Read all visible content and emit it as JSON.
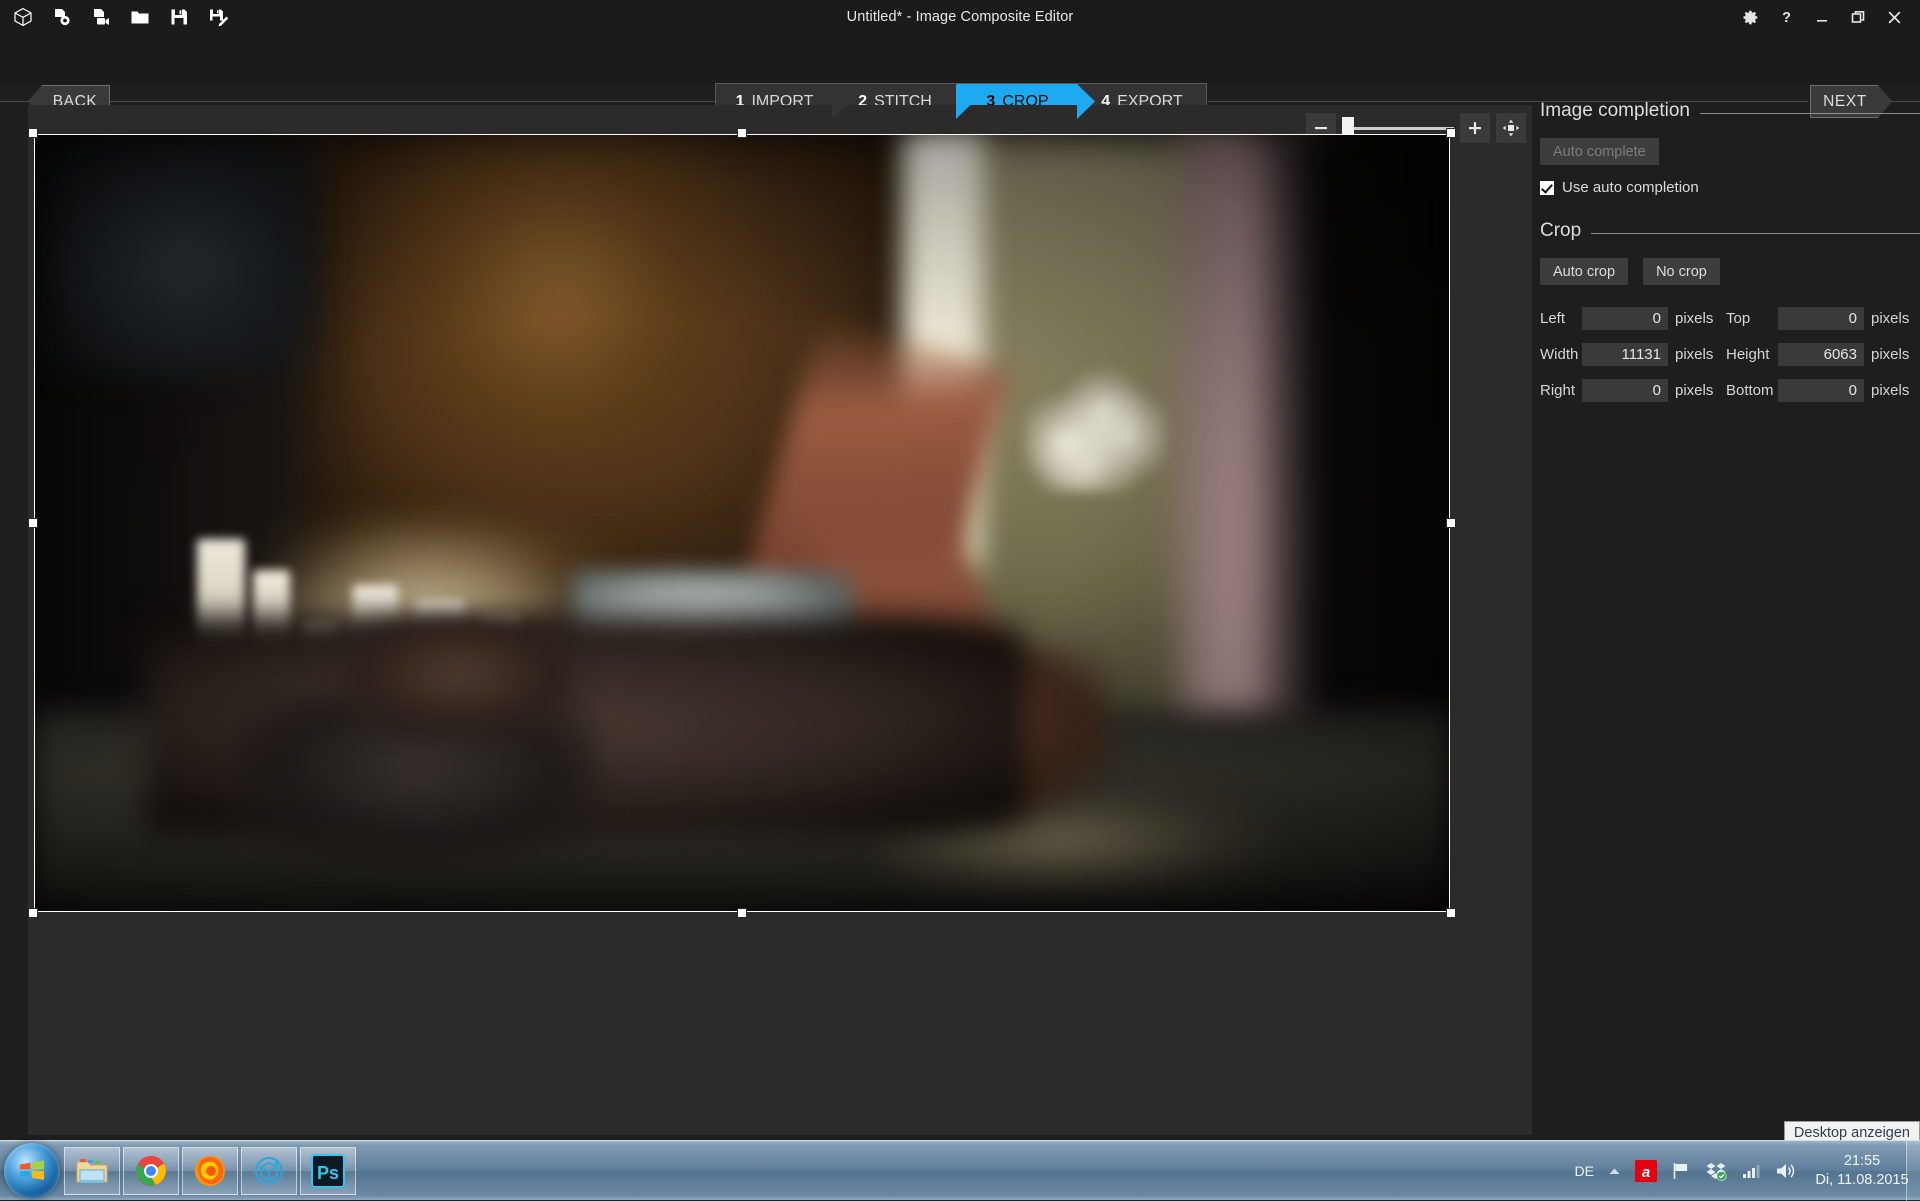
{
  "window": {
    "title": "Untitled* - Image Composite Editor",
    "toolbar_icons": [
      {
        "name": "app-cube-icon",
        "label": "Image Composite Editor"
      },
      {
        "name": "new-panorama-from-images-icon",
        "label": "New panorama from images"
      },
      {
        "name": "new-panorama-from-video-icon",
        "label": "New panorama from video"
      },
      {
        "name": "open-icon",
        "label": "Open"
      },
      {
        "name": "save-icon",
        "label": "Save"
      },
      {
        "name": "save-as-icon",
        "label": "Save as"
      }
    ],
    "controls": [
      {
        "name": "settings-gear-icon",
        "label": "Settings"
      },
      {
        "name": "help-icon",
        "label": "Help"
      },
      {
        "name": "minimize-icon",
        "label": "Minimize"
      },
      {
        "name": "maximize-icon",
        "label": "Restore"
      },
      {
        "name": "close-icon",
        "label": "Close"
      }
    ]
  },
  "nav": {
    "back_label": "BACK",
    "next_label": "NEXT",
    "steps": [
      {
        "num": "1",
        "label": "IMPORT",
        "active": false
      },
      {
        "num": "2",
        "label": "STITCH",
        "active": false
      },
      {
        "num": "3",
        "label": "CROP",
        "active": true
      },
      {
        "num": "4",
        "label": "EXPORT",
        "active": false
      }
    ],
    "active_color": "#1eaaf0"
  },
  "canvas": {
    "zoom_out_label": "−",
    "zoom_in_label": "+",
    "fit_label": "Fit to window",
    "slider_value": 4
  },
  "panel": {
    "image_completion": {
      "title": "Image completion",
      "auto_complete_label": "Auto complete",
      "auto_complete_disabled": true,
      "use_auto_completion_label": "Use auto completion",
      "use_auto_completion_checked": true
    },
    "crop": {
      "title": "Crop",
      "auto_crop_label": "Auto crop",
      "no_crop_label": "No crop",
      "unit_label": "pixels",
      "fields": [
        {
          "label": "Left",
          "value": "0"
        },
        {
          "label": "Top",
          "value": "0"
        },
        {
          "label": "Width",
          "value": "11131"
        },
        {
          "label": "Height",
          "value": "6063"
        },
        {
          "label": "Right",
          "value": "0"
        },
        {
          "label": "Bottom",
          "value": "0"
        }
      ]
    }
  },
  "taskbar": {
    "start_label": "Start",
    "items": [
      {
        "name": "taskbar-item-explorer",
        "label": "Windows Explorer"
      },
      {
        "name": "taskbar-item-chrome",
        "label": "Google Chrome"
      },
      {
        "name": "taskbar-item-firefox",
        "label": "Mozilla Firefox"
      },
      {
        "name": "taskbar-item-ice",
        "label": "Image Composite Editor"
      },
      {
        "name": "taskbar-item-photoshop",
        "label": "Ps"
      }
    ],
    "tray": {
      "language": "DE",
      "show_hidden_label": "▴",
      "icons": [
        {
          "name": "avira-icon",
          "label": "Avira"
        },
        {
          "name": "action-center-flag-icon",
          "label": "Action Center"
        },
        {
          "name": "dropbox-icon",
          "label": "Dropbox"
        },
        {
          "name": "network-icon",
          "label": "Network"
        },
        {
          "name": "volume-icon",
          "label": "Volume"
        }
      ],
      "time": "21:55",
      "date": "Di, 11.08.2015"
    },
    "show_desktop_tooltip": "Desktop anzeigen"
  }
}
